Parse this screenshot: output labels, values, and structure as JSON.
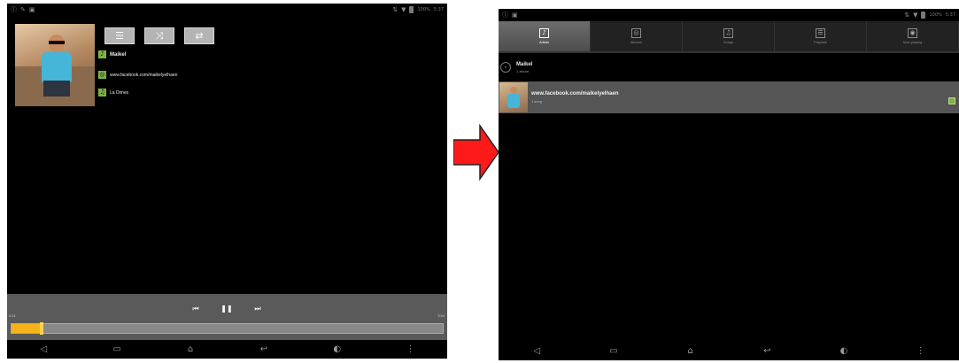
{
  "left_screen": {
    "status_left": [
      "ⓘ",
      "✎",
      "▣"
    ],
    "status_right": [
      "⇅",
      "▼",
      "100%",
      "5:37"
    ],
    "controls": {
      "queue_glyph": "☰",
      "shuffle_glyph": "⤨",
      "repeat_glyph": "⇄"
    },
    "now_playing": {
      "artist_icon": "♪",
      "artist": "Maikel",
      "album_icon": "◎",
      "album": "www.facebook.com/maikelyelhaen",
      "track_icon": "♫",
      "track": "La Dimes"
    },
    "player": {
      "prev_glyph": "⏮",
      "pause_glyph": "❚❚",
      "next_glyph": "⏭",
      "time_current": "0:11",
      "time_total": "3:44",
      "progress": 0.07
    },
    "nav": [
      "◁",
      "▭",
      "⌂",
      "↩",
      "◐",
      "⋮"
    ]
  },
  "right_screen": {
    "status_left": [
      "ⓘ",
      "▣"
    ],
    "status_right": [
      "⇅",
      "▼",
      "100%",
      "5:37"
    ],
    "tabs": [
      {
        "icon": "♪",
        "label": "Artists"
      },
      {
        "icon": "◎",
        "label": "Albums"
      },
      {
        "icon": "♫",
        "label": "Songs"
      },
      {
        "icon": "☰",
        "label": "Playlists"
      },
      {
        "icon": "◉",
        "label": "Now playing"
      }
    ],
    "artist": {
      "name": "Maikel",
      "count": "1 album"
    },
    "album": {
      "title": "www.facebook.com/maikelyelhaen",
      "subtitle": "1 song"
    },
    "nav": [
      "◁",
      "▭",
      "⌂",
      "↩",
      "◐",
      "⋮"
    ]
  },
  "colors": {
    "accent_green": "#7cb342",
    "progress_orange": "#f5b319",
    "arrow_red": "#ff1a1a"
  }
}
